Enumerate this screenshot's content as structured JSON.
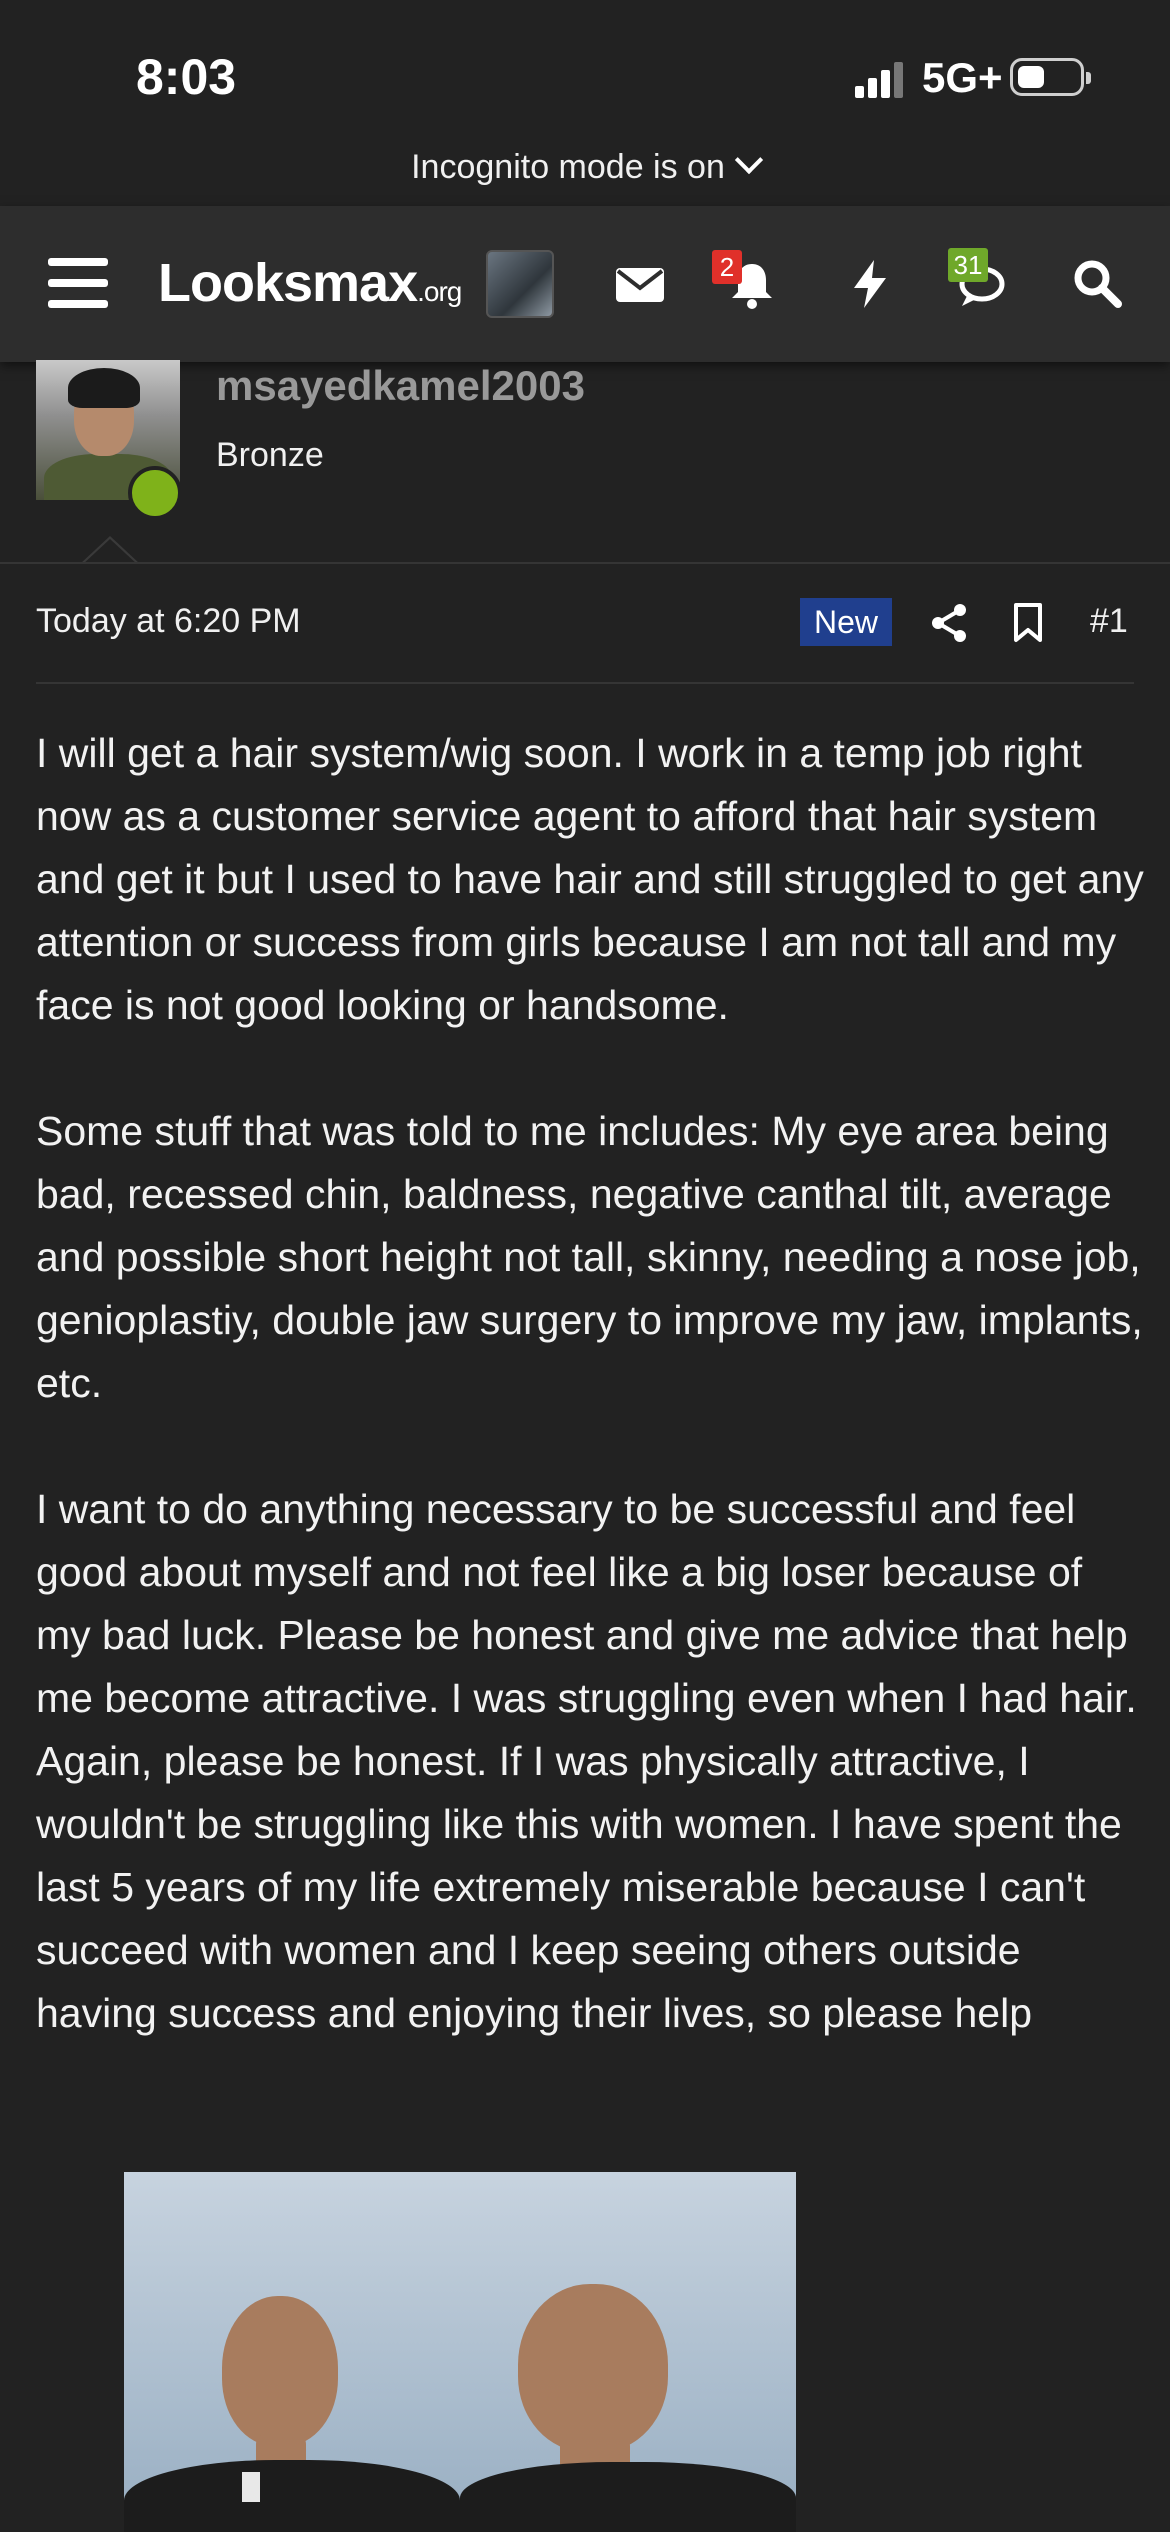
{
  "status_bar": {
    "time": "8:03",
    "network": "5G+"
  },
  "browser": {
    "incognito_text": "Incognito mode is on"
  },
  "nav": {
    "logo_main": "Looksmax",
    "logo_suffix": ".org",
    "alerts_badge": "2",
    "conversations_badge": "31",
    "colors": {
      "alerts_badge": "#e0302a",
      "conversations_badge": "#6fa82a"
    }
  },
  "post": {
    "author": "msayedkamel2003",
    "rank": "Bronze",
    "date": "Today at 6:20 PM",
    "new_label": "New",
    "post_number": "#1",
    "paragraphs": [
      "I will get a hair system/wig soon. I work in a temp job right now as a customer service agent to afford that hair system and get it but I used to have hair and still struggled to get any attention or success from girls because I am not tall and my face is not good looking or handsome.",
      "Some stuff that was told to me includes: My eye area being bad, recessed chin, baldness, negative canthal tilt, average and possible short height not tall, skinny, needing a nose job, genioplastiy, double jaw surgery to improve my jaw, implants, etc.",
      "I want to do anything necessary to be successful and feel good about myself and not feel like a big loser because of my bad luck. Please be honest and give me advice that help me become attractive. I was struggling even when I had hair. Again, please be honest. If I was physically attractive, I wouldn't be struggling like this with women. I have spent the last 5 years of my life extremely miserable because I can't succeed with women and I keep seeing others outside having success and enjoying their lives, so please help"
    ],
    "colors": {
      "new_badge": "#203f8e",
      "online": "#7fb21a",
      "username": "#999999"
    }
  }
}
